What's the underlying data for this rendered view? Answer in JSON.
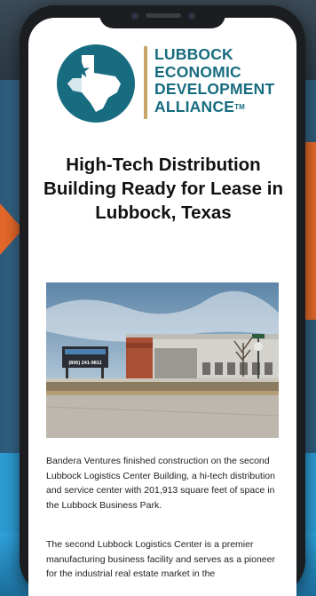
{
  "logo": {
    "line1": "LUBBOCK",
    "line2": "ECONOMIC",
    "line3": "DEVELOPMENT",
    "line4": "ALLIANCE",
    "trademark": "TM",
    "icon": "texas-state-icon"
  },
  "article": {
    "headline": "High-Tech Distribution Building Ready for Lease in Lubbock, Texas",
    "photo": {
      "sign_phone": "(806) 241-9811",
      "icon": "warehouse-building-photo"
    },
    "paragraph1": "Bandera Ventures finished construction on the second Lubbock Logistics Center Building, a hi-tech distribution and service center with 201,913 square feet of space in the Lubbock Business Park.",
    "paragraph2": "The second Lubbock Logistics Center is a premier manufacturing business facility and serves as a pioneer for the industrial real estate market in the"
  },
  "colors": {
    "brand_teal": "#186c80",
    "accent_gold": "#c8a36a",
    "orange": "#e4682a",
    "blue": "#2c9bd2"
  }
}
